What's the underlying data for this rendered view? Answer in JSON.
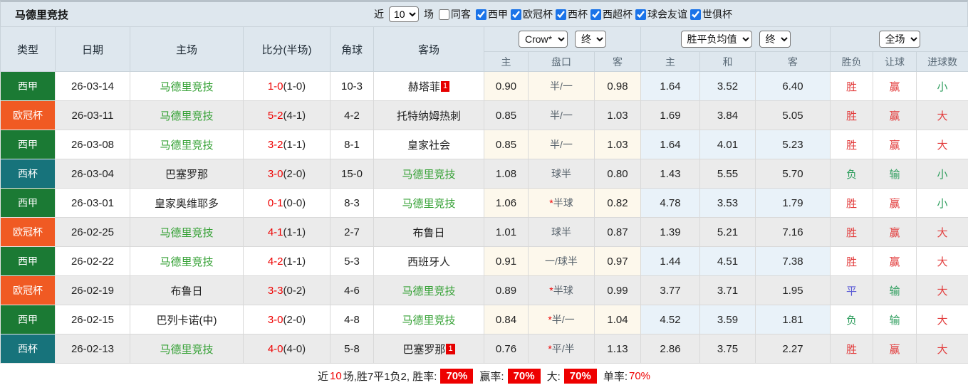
{
  "title": "马德里竞技",
  "colors": {
    "league_liga_green": "#1b7a34",
    "league_ucl_orange": "#f05a23",
    "league_copa_teal": "#17737b",
    "team_green": "#33a033",
    "score_red": "#ee0000",
    "win_red": "#e23b3b",
    "lose_green": "#2f9e5e",
    "draw_blue": "#5b5bd6",
    "badge_red": "#ee0000",
    "header_bg": "#dee7ee",
    "crow_col_bg": "#fdf8ec",
    "avg_col_bg": "#e9f2f9"
  },
  "filters": {
    "recent_label": "近",
    "recent_value": "10",
    "matches_label": "场",
    "same_venue": {
      "label": "同客",
      "checked": false
    },
    "leagues": [
      {
        "label": "西甲",
        "checked": true
      },
      {
        "label": "欧冠杯",
        "checked": true
      },
      {
        "label": "西杯",
        "checked": true
      },
      {
        "label": "西超杯",
        "checked": true
      },
      {
        "label": "球会友谊",
        "checked": true
      },
      {
        "label": "世俱杯",
        "checked": true
      }
    ]
  },
  "table": {
    "columns": [
      "类型",
      "日期",
      "主场",
      "比分(半场)",
      "角球",
      "客场"
    ],
    "selects": {
      "company": "Crow*",
      "company_period": "终",
      "avg": "胜平负均值",
      "avg_period": "终",
      "scope": "全场"
    },
    "sub_columns": [
      "主",
      "盘口",
      "客",
      "主",
      "和",
      "客",
      "胜负",
      "让球",
      "进球数"
    ],
    "rows": [
      {
        "type": "西甲",
        "type_color": "#1b7a34",
        "date": "26-03-14",
        "home": "马德里竞技",
        "home_self": true,
        "score": "1-0",
        "half": "(1-0)",
        "corner": "10-3",
        "away": "赫塔菲",
        "away_self": false,
        "away_card": "1",
        "crow": {
          "home": "0.90",
          "handicap": "半/一",
          "star": false,
          "away": "0.98"
        },
        "avg": {
          "home": "1.64",
          "draw": "3.52",
          "away": "6.40"
        },
        "result": {
          "outcome": "胜",
          "outcome_c": "r",
          "handicap": "赢",
          "handicap_c": "r",
          "goals": "小",
          "goals_c": "g"
        }
      },
      {
        "type": "欧冠杯",
        "type_color": "#f05a23",
        "date": "26-03-11",
        "home": "马德里竞技",
        "home_self": true,
        "score": "5-2",
        "half": "(4-1)",
        "corner": "4-2",
        "away": "托特纳姆热刺",
        "away_self": false,
        "away_card": "",
        "crow": {
          "home": "0.85",
          "handicap": "半/一",
          "star": false,
          "away": "1.03"
        },
        "avg": {
          "home": "1.69",
          "draw": "3.84",
          "away": "5.05"
        },
        "result": {
          "outcome": "胜",
          "outcome_c": "r",
          "handicap": "赢",
          "handicap_c": "r",
          "goals": "大",
          "goals_c": "r"
        }
      },
      {
        "type": "西甲",
        "type_color": "#1b7a34",
        "date": "26-03-08",
        "home": "马德里竞技",
        "home_self": true,
        "score": "3-2",
        "half": "(1-1)",
        "corner": "8-1",
        "away": "皇家社会",
        "away_self": false,
        "away_card": "",
        "crow": {
          "home": "0.85",
          "handicap": "半/一",
          "star": false,
          "away": "1.03"
        },
        "avg": {
          "home": "1.64",
          "draw": "4.01",
          "away": "5.23"
        },
        "result": {
          "outcome": "胜",
          "outcome_c": "r",
          "handicap": "赢",
          "handicap_c": "r",
          "goals": "大",
          "goals_c": "r"
        }
      },
      {
        "type": "西杯",
        "type_color": "#17737b",
        "date": "26-03-04",
        "home": "巴塞罗那",
        "home_self": false,
        "score": "3-0",
        "half": "(2-0)",
        "corner": "15-0",
        "away": "马德里竞技",
        "away_self": true,
        "away_card": "",
        "crow": {
          "home": "1.08",
          "handicap": "球半",
          "star": false,
          "away": "0.80"
        },
        "avg": {
          "home": "1.43",
          "draw": "5.55",
          "away": "5.70"
        },
        "result": {
          "outcome": "负",
          "outcome_c": "g",
          "handicap": "输",
          "handicap_c": "g",
          "goals": "小",
          "goals_c": "g"
        }
      },
      {
        "type": "西甲",
        "type_color": "#1b7a34",
        "date": "26-03-01",
        "home": "皇家奥维耶多",
        "home_self": false,
        "score": "0-1",
        "half": "(0-0)",
        "corner": "8-3",
        "away": "马德里竞技",
        "away_self": true,
        "away_card": "",
        "crow": {
          "home": "1.06",
          "handicap": "半球",
          "star": true,
          "away": "0.82"
        },
        "avg": {
          "home": "4.78",
          "draw": "3.53",
          "away": "1.79"
        },
        "result": {
          "outcome": "胜",
          "outcome_c": "r",
          "handicap": "赢",
          "handicap_c": "r",
          "goals": "小",
          "goals_c": "g"
        }
      },
      {
        "type": "欧冠杯",
        "type_color": "#f05a23",
        "date": "26-02-25",
        "home": "马德里竞技",
        "home_self": true,
        "score": "4-1",
        "half": "(1-1)",
        "corner": "2-7",
        "away": "布鲁日",
        "away_self": false,
        "away_card": "",
        "crow": {
          "home": "1.01",
          "handicap": "球半",
          "star": false,
          "away": "0.87"
        },
        "avg": {
          "home": "1.39",
          "draw": "5.21",
          "away": "7.16"
        },
        "result": {
          "outcome": "胜",
          "outcome_c": "r",
          "handicap": "赢",
          "handicap_c": "r",
          "goals": "大",
          "goals_c": "r"
        }
      },
      {
        "type": "西甲",
        "type_color": "#1b7a34",
        "date": "26-02-22",
        "home": "马德里竞技",
        "home_self": true,
        "score": "4-2",
        "half": "(1-1)",
        "corner": "5-3",
        "away": "西班牙人",
        "away_self": false,
        "away_card": "",
        "crow": {
          "home": "0.91",
          "handicap": "一/球半",
          "star": false,
          "away": "0.97"
        },
        "avg": {
          "home": "1.44",
          "draw": "4.51",
          "away": "7.38"
        },
        "result": {
          "outcome": "胜",
          "outcome_c": "r",
          "handicap": "赢",
          "handicap_c": "r",
          "goals": "大",
          "goals_c": "r"
        }
      },
      {
        "type": "欧冠杯",
        "type_color": "#f05a23",
        "date": "26-02-19",
        "home": "布鲁日",
        "home_self": false,
        "score": "3-3",
        "half": "(0-2)",
        "corner": "4-6",
        "away": "马德里竞技",
        "away_self": true,
        "away_card": "",
        "crow": {
          "home": "0.89",
          "handicap": "半球",
          "star": true,
          "away": "0.99"
        },
        "avg": {
          "home": "3.77",
          "draw": "3.71",
          "away": "1.95"
        },
        "result": {
          "outcome": "平",
          "outcome_c": "b",
          "handicap": "输",
          "handicap_c": "g",
          "goals": "大",
          "goals_c": "r"
        }
      },
      {
        "type": "西甲",
        "type_color": "#1b7a34",
        "date": "26-02-15",
        "home": "巴列卡诺(中)",
        "home_self": false,
        "score": "3-0",
        "half": "(2-0)",
        "corner": "4-8",
        "away": "马德里竞技",
        "away_self": true,
        "away_card": "",
        "crow": {
          "home": "0.84",
          "handicap": "半/一",
          "star": true,
          "away": "1.04"
        },
        "avg": {
          "home": "4.52",
          "draw": "3.59",
          "away": "1.81"
        },
        "result": {
          "outcome": "负",
          "outcome_c": "g",
          "handicap": "输",
          "handicap_c": "g",
          "goals": "大",
          "goals_c": "r"
        }
      },
      {
        "type": "西杯",
        "type_color": "#17737b",
        "date": "26-02-13",
        "home": "马德里竞技",
        "home_self": true,
        "score": "4-0",
        "half": "(4-0)",
        "corner": "5-8",
        "away": "巴塞罗那",
        "away_self": false,
        "away_card": "1",
        "crow": {
          "home": "0.76",
          "handicap": "平/半",
          "star": true,
          "away": "1.13"
        },
        "avg": {
          "home": "2.86",
          "draw": "3.75",
          "away": "2.27"
        },
        "result": {
          "outcome": "胜",
          "outcome_c": "r",
          "handicap": "赢",
          "handicap_c": "r",
          "goals": "大",
          "goals_c": "r"
        }
      }
    ]
  },
  "footer": {
    "near_label": "近",
    "near_count": "10",
    "record_text": "场,胜7平1负2, 胜率:",
    "win_rate_badge": "70%",
    "handicap_label": "赢率:",
    "handicap_badge": "70%",
    "big_label": "大:",
    "big_badge": "70%",
    "single_label": "单率:",
    "single_rate": "70%"
  }
}
